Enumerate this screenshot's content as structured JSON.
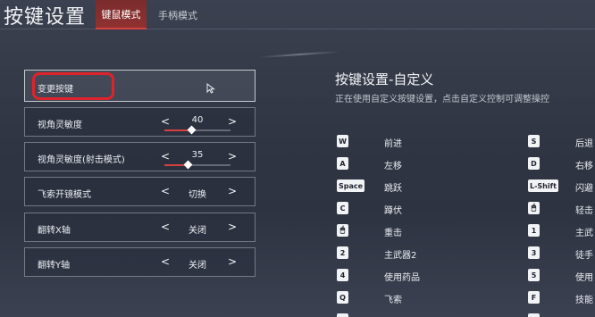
{
  "header": {
    "title": "按键设置",
    "tabs": [
      {
        "label": "键鼠模式",
        "active": true
      },
      {
        "label": "手柄模式",
        "active": false
      }
    ]
  },
  "settings": {
    "change_binding_label": "变更按键",
    "rows": [
      {
        "label": "视角灵敏度",
        "value": "40",
        "slider_fraction": 0.4
      },
      {
        "label": "视角灵敏度(射击模式)",
        "value": "35",
        "slider_fraction": 0.35
      },
      {
        "label": "飞索开镜模式",
        "value": "切换"
      },
      {
        "label": "翻转X轴",
        "value": "关闭"
      },
      {
        "label": "翻转Y轴",
        "value": "关闭"
      }
    ],
    "arrow_left": "<",
    "arrow_right": ">"
  },
  "panel": {
    "title": "按键设置-自定义",
    "description": "正在使用自定义按键设置，点击自定义控制可调整操控"
  },
  "bindings_left": [
    {
      "key": "W",
      "action": "前进"
    },
    {
      "key": "A",
      "action": "左移"
    },
    {
      "key": "Space",
      "action": "跳跃"
    },
    {
      "key": "C",
      "action": "蹲伏"
    },
    {
      "key": "🖱",
      "action": "重击"
    },
    {
      "key": "2",
      "action": "主武器2"
    },
    {
      "key": "4",
      "action": "使用药品"
    },
    {
      "key": "Q",
      "action": "飞索"
    },
    {
      "key": "G",
      "action": "技能2"
    }
  ],
  "bindings_right": [
    {
      "key": "S",
      "action": "后退"
    },
    {
      "key": "D",
      "action": "右移"
    },
    {
      "key": "L-Shift",
      "action": "闪避"
    },
    {
      "key": "🖱",
      "action": "轻击"
    },
    {
      "key": "1",
      "action": "主武"
    },
    {
      "key": "3",
      "action": "徒手"
    },
    {
      "key": "5",
      "action": "使用"
    },
    {
      "key": "F",
      "action": "技能"
    },
    {
      "key": "V",
      "action": "奥义"
    }
  ],
  "colors": {
    "accent_red": "#d94040",
    "tab_active_bg": "#8f3131",
    "highlight_ring": "#e0222a"
  }
}
